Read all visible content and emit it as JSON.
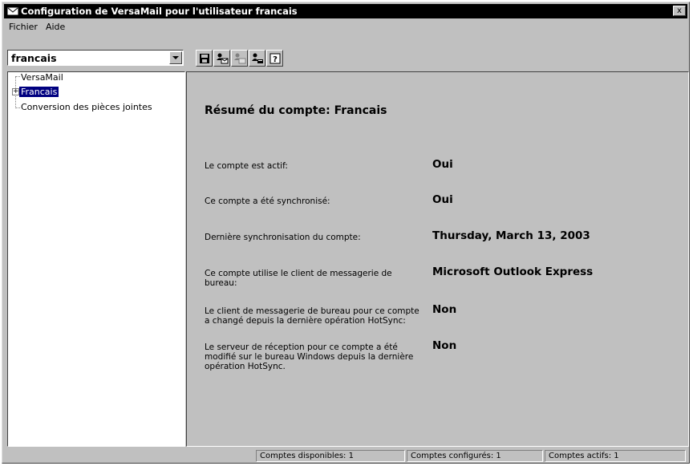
{
  "window": {
    "title": "Configuration de VersaMail pour l'utilisateur francais",
    "close_glyph": "x"
  },
  "menu": {
    "items": [
      "Fichier",
      "Aide"
    ]
  },
  "user_combo": {
    "value": "francais"
  },
  "toolbar": {
    "buttons": [
      "save-icon",
      "add-account-icon",
      "delete-account-icon",
      "account-settings-icon",
      "help-icon"
    ]
  },
  "tree": {
    "items": [
      "VersaMail",
      "Francais",
      "Conversion des pièces jointes"
    ],
    "expander": "+"
  },
  "summary": {
    "title": "Résumé du compte: Francais",
    "rows": [
      {
        "label": "Le compte est actif:",
        "value": "Oui"
      },
      {
        "label": "Ce compte a été synchronisé:",
        "value": "Oui"
      },
      {
        "label": "Dernière synchronisation du compte:",
        "value": "Thursday, March 13, 2003"
      },
      {
        "label": "Ce compte utilise le client de messagerie de bureau:",
        "value": "Microsoft Outlook Express"
      },
      {
        "label": "Le client de messagerie de bureau pour ce compte a changé depuis la dernière opération HotSync:",
        "value": "Non"
      },
      {
        "label": "Le serveur de réception pour ce compte a été modifié sur le bureau Windows depuis la dernière opération HotSync.",
        "value": "Non"
      }
    ]
  },
  "status": {
    "available": "Comptes disponibles: 1",
    "configured": "Comptes configurés: 1",
    "active": "Comptes actifs: 1"
  }
}
